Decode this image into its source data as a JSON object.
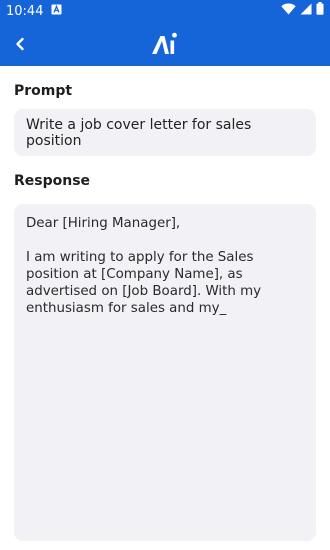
{
  "status_bar": {
    "time": "10:44",
    "notification_icon": "a-notification-icon",
    "wifi_icon": "wifi-icon",
    "signal_icon": "cell-signal-icon",
    "battery_icon": "battery-icon"
  },
  "app_bar": {
    "back_icon": "chevron-left-icon",
    "logo_icon": "ai-logo-icon"
  },
  "prompt": {
    "label": "Prompt",
    "value": "Write a job cover letter for sales position"
  },
  "response": {
    "label": "Response",
    "text": "Dear [Hiring Manager],\n\nI am writing to apply for the Sales position at [Company Name], as advertised on [Job Board]. With my enthusiasm for sales and my_"
  },
  "colors": {
    "primary": "#1565d8",
    "field_background": "#f1f1f6"
  }
}
